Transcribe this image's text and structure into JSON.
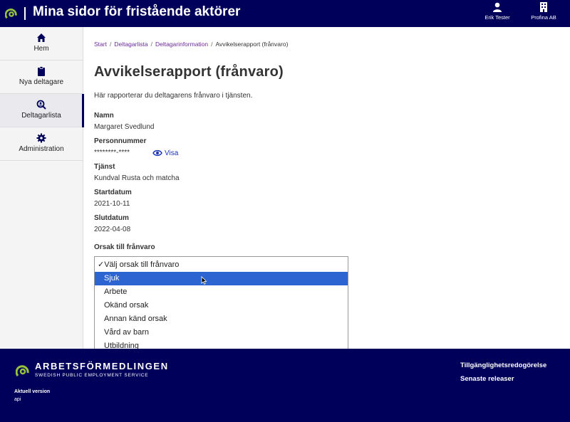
{
  "header": {
    "title": "Mina sidor för fristående aktörer",
    "user_name": "Erik Tester",
    "org_name": "Profina AB"
  },
  "sidebar": {
    "items": [
      {
        "label": "Hem",
        "icon": "home-icon"
      },
      {
        "label": "Nya deltagare",
        "icon": "clipboard-icon"
      },
      {
        "label": "Deltagarlista",
        "icon": "search-user-icon",
        "active": true
      },
      {
        "label": "Administration",
        "icon": "gear-icon"
      }
    ]
  },
  "breadcrumb": {
    "items": [
      "Start",
      "Deltagarlista",
      "Deltagarinformation"
    ],
    "current": "Avvikelserapport (frånvaro)",
    "separator": "/"
  },
  "page": {
    "title": "Avvikelserapport (frånvaro)",
    "intro": "Här rapporterar du deltagarens frånvaro i tjänsten."
  },
  "fields": {
    "name_label": "Namn",
    "name_value": "Margaret Svedlund",
    "pnr_label": "Personnummer",
    "pnr_value": "********-****",
    "show_label": "Visa",
    "service_label": "Tjänst",
    "service_value": "Kundval Rusta och matcha",
    "start_label": "Startdatum",
    "start_value": "2021-10-11",
    "end_label": "Slutdatum",
    "end_value": "2022-04-08",
    "reason_label": "Orsak till frånvaro"
  },
  "dropdown": {
    "options": [
      "✓Välj orsak till frånvaro",
      "Sjuk",
      "Arbete",
      "Okänd orsak",
      "Annan känd orsak",
      "Vård av barn",
      "Utbildning"
    ],
    "highlighted_index": 1
  },
  "footer": {
    "brand": "ARBETSFÖRMEDLINGEN",
    "brand_sub": "SWEDISH PUBLIC EMPLOYMENT SERVICE",
    "version_label": "Aktuell version",
    "version_value": "api",
    "links": [
      "Tillgänglighetsredogörelse",
      "Senaste releaser"
    ]
  },
  "colors": {
    "brand_navy": "#00005a",
    "brand_green": "#95c23d",
    "link_purple": "#6b2a9a",
    "highlight_blue": "#2c65d2"
  }
}
